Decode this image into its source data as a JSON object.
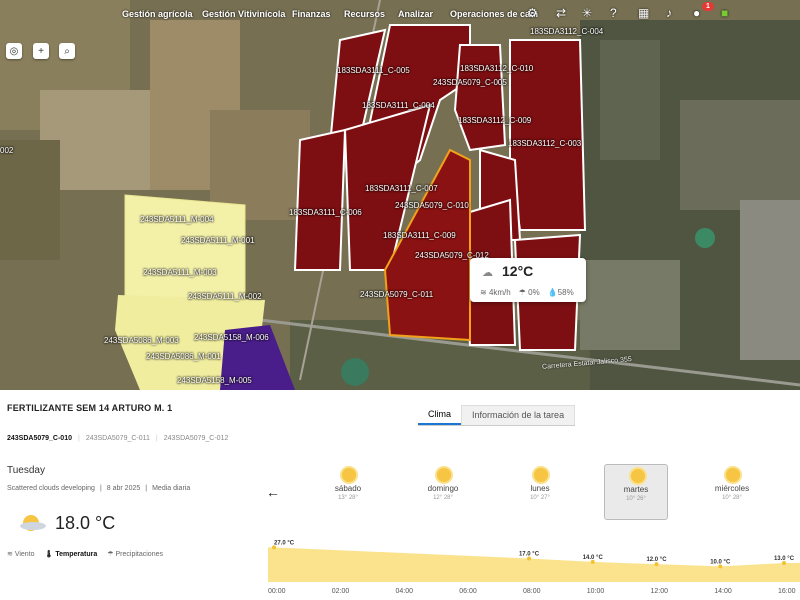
{
  "nav": {
    "items": [
      "Gestión agrícola",
      "Gestión Vitivinícola",
      "Finanzas",
      "Recursos",
      "Analizar",
      "Operaciones de cam"
    ],
    "notification_count": "1"
  },
  "map": {
    "plot_labels": [
      "183SDA3112_C-004",
      "183SDA3111_C-005",
      "183SDA3112_C-010",
      "243SDA5079_C-005",
      "183SDA3111_C-004",
      "183SDA3112_C-009",
      "183SDA3112_C-003",
      "183SDA3111_C-007",
      "243SDA5079_C-010",
      "183SDA3111_C-006",
      "183SDA3111_C-009",
      "243SDA5079_C-012",
      "243SDA5079_C-011",
      "243SDA5111_M-004",
      "243SDA5111_M-001",
      "243SDA5111_M-003",
      "243SDA5111_M-002",
      "243SDA5086_M-003",
      "243SDA5158_M-006",
      "243SDA5086_M-001",
      "243SDA5158_M-005",
      "002"
    ],
    "road_label": "Carretera Estatal Jalisco 355",
    "popup": {
      "temperature": "12°C",
      "wind": "4km/h",
      "precip": "0%",
      "humidity": "58%"
    }
  },
  "panel": {
    "task_title": "FERTILIZANTE SEM 14 ARTURO M. 1",
    "tabs": [
      "Clima",
      "Información de la tarea"
    ],
    "plots": [
      "243SDA5079_C-010",
      "243SDA5079_C-011",
      "243SDA5079_C-012"
    ],
    "day_name": "Tuesday",
    "condition": "Scattered clouds developing",
    "date": "8 abr 2025",
    "mode": "Media diaria",
    "current_temp": "18.0 °C",
    "metrics": [
      "Viento",
      "Temperatura",
      "Precipitaciones"
    ],
    "forecast": [
      {
        "day": "sábado",
        "range": "13° 28°"
      },
      {
        "day": "domingo",
        "range": "12° 28°"
      },
      {
        "day": "lunes",
        "range": "10° 27°"
      },
      {
        "day": "martes",
        "range": "10° 26°"
      },
      {
        "day": "miércoles",
        "range": "10° 28°"
      }
    ],
    "hours": [
      "00:00",
      "02:00",
      "04:00",
      "06:00",
      "08:00",
      "10:00",
      "12:00",
      "14:00",
      "16:00"
    ]
  },
  "chart_data": {
    "type": "area",
    "x": [
      "00:00",
      "08:00",
      "10:00",
      "12:00",
      "14:00",
      "16:00"
    ],
    "series": [
      {
        "values": [
          27.0,
          17.0,
          14.0,
          12.0,
          10.0,
          13.0
        ]
      }
    ],
    "labels": [
      "27.0 °C",
      "17.0 °C",
      "14.0 °C",
      "12.0 °C",
      "10.0 °C",
      "13.0 °C"
    ],
    "color": "#fbe38e"
  }
}
